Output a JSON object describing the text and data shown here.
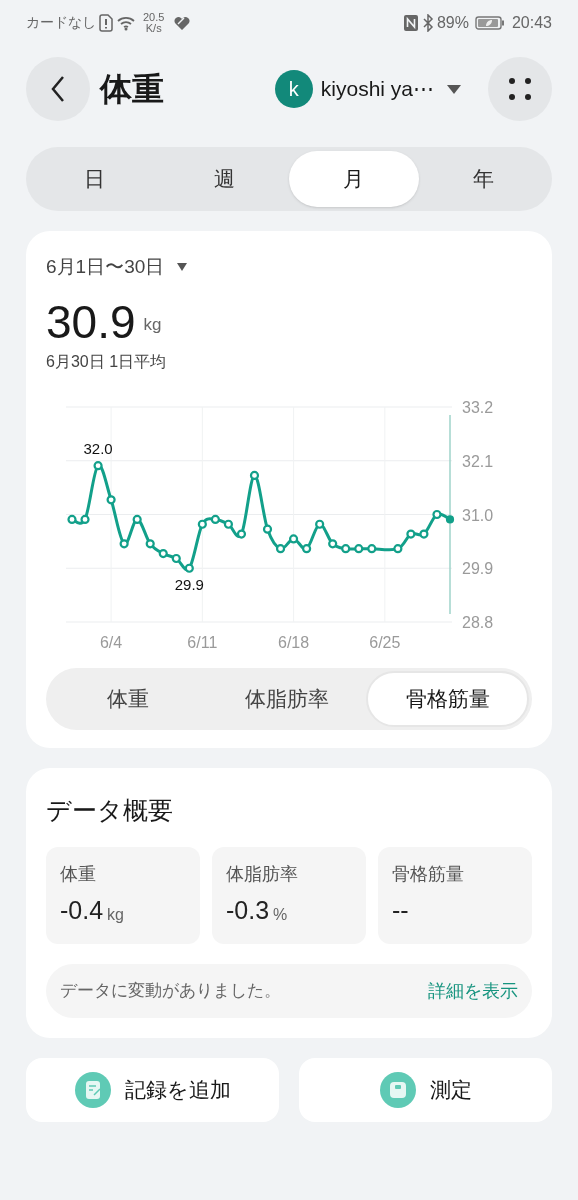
{
  "status_bar": {
    "carrier": "カードなし",
    "speed_value": "20.5",
    "speed_unit": "K/s",
    "battery": "89%",
    "time": "20:43"
  },
  "header": {
    "title": "体重",
    "avatar_letter": "k",
    "user_name": "kiyoshi ya⋯"
  },
  "period_tabs": [
    {
      "label": "日",
      "selected": false
    },
    {
      "label": "週",
      "selected": false
    },
    {
      "label": "月",
      "selected": true
    },
    {
      "label": "年",
      "selected": false
    }
  ],
  "summary_card": {
    "date_range": "6月1日〜30日",
    "value": "30.9",
    "unit": "kg",
    "caption": "6月30日 1日平均",
    "chart_data": {
      "type": "line",
      "categories": [
        null,
        null,
        null,
        "6/4",
        null,
        null,
        null,
        null,
        null,
        null,
        "6/11",
        null,
        null,
        null,
        null,
        null,
        null,
        "6/18",
        null,
        null,
        null,
        null,
        null,
        null,
        "6/25",
        null,
        null,
        null,
        null,
        null
      ],
      "series": [
        {
          "color": "#12a08a",
          "marker": "circle",
          "values": [
            30.9,
            30.9,
            32.0,
            31.3,
            30.4,
            30.9,
            30.4,
            30.2,
            30.1,
            29.9,
            30.8,
            30.9,
            30.8,
            30.6,
            31.8,
            30.7,
            30.3,
            30.5,
            30.3,
            30.8,
            30.4,
            30.3,
            30.3,
            30.3,
            null,
            30.3,
            30.6,
            30.6,
            31.0,
            30.9
          ]
        }
      ],
      "ylim": [
        28.8,
        33.2
      ],
      "yticks": [
        {
          "value": 33.2,
          "label": "33.2"
        },
        {
          "value": 32.1,
          "label": "32.1"
        },
        {
          "value": 31.0,
          "label": "31.0"
        },
        {
          "value": 29.9,
          "label": "29.9"
        },
        {
          "value": 28.8,
          "label": "28.8"
        }
      ],
      "grid": true,
      "annotations": [
        {
          "y": 32.0,
          "text": "32.0"
        },
        {
          "y": 29.9,
          "text": "29.9"
        }
      ]
    },
    "metric_tabs": [
      {
        "label": "体重",
        "selected": false
      },
      {
        "label": "体脂肪率",
        "selected": false
      },
      {
        "label": "骨格筋量",
        "selected": true
      }
    ]
  },
  "data_overview": {
    "title": "データ概要",
    "tiles": [
      {
        "label": "体重",
        "value": "-0.4",
        "unit": "kg"
      },
      {
        "label": "体脂肪率",
        "value": "-0.3",
        "unit": "%"
      },
      {
        "label": "骨格筋量",
        "value": "--"
      }
    ],
    "notice": "データに変動がありました。",
    "link": "詳細を表示"
  },
  "actions": [
    {
      "kind": "record",
      "label": "記録を追加"
    },
    {
      "kind": "measure",
      "label": "測定"
    }
  ]
}
